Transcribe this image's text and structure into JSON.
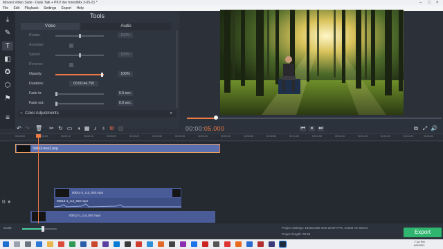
{
  "window": {
    "title": "Movavi Video Suite - Daily Talk + PKV live forestMix 3-05-21 *"
  },
  "menu": [
    "File",
    "Edit",
    "Playback",
    "Settings",
    "Export",
    "Help"
  ],
  "sidetools": [
    "import-icon",
    "pen-icon",
    "titles-icon",
    "filters-icon",
    "stickers-icon",
    "transitions-icon",
    "motion-icon",
    "more-icon"
  ],
  "tools": {
    "title": "Tools",
    "tabs": [
      "Video",
      "Audio"
    ],
    "rows": {
      "rotate": {
        "label": "Rotate:",
        "value": "100%"
      },
      "autoplay": {
        "label": "Autoplay:"
      },
      "speed": {
        "label": "Speed:",
        "value": "100%"
      },
      "reverse": {
        "label": "Reverse:"
      },
      "opacity": {
        "label": "Opacity:",
        "value": "100%"
      },
      "duration": {
        "label": "Duration:",
        "value": "00:00:44.750"
      },
      "fade_in": {
        "label": "Fade in:",
        "value": "0.0 sec."
      },
      "fade_out": {
        "label": "Fade out:",
        "value": "0.0 sec."
      }
    },
    "color_adjustments": "Color Adjustments",
    "collapse": "»"
  },
  "timecode": {
    "static": "00:00:",
    "running": "05.000"
  },
  "ruler": [
    "00:00:00",
    "00:00:05",
    "00:00:10",
    "00:00:15",
    "00:00:20",
    "00:00:25",
    "00:00:30",
    "00:00:35",
    "00:00:40",
    "00:00:45",
    "00:00:50",
    "00:00:55",
    "00:01:00",
    "00:01:05",
    "00:01:10",
    "00:01:15",
    "00:01:20",
    "00:01:25",
    "00:01:30"
  ],
  "clips": {
    "slide": "Slide3-tree2.png",
    "video_a": "00014-1_cut_002.mp4",
    "audio_a": "00014-1_cut_002.mp4",
    "video_b": "00012-1_cut_007.mp4"
  },
  "footer": {
    "scale": "Scale:",
    "project_settings": "Project settings: 1920x1080 16:9 29.97 FPS, 44100 Hz Stereo",
    "project_length": "Project length: 00:45",
    "export": "Export"
  },
  "clock": {
    "time": "7:16 PM",
    "date": "8/5/2021"
  },
  "colors": {
    "accent": "#f07a44",
    "export": "#2fb56f",
    "clip": "#4a5c98"
  }
}
